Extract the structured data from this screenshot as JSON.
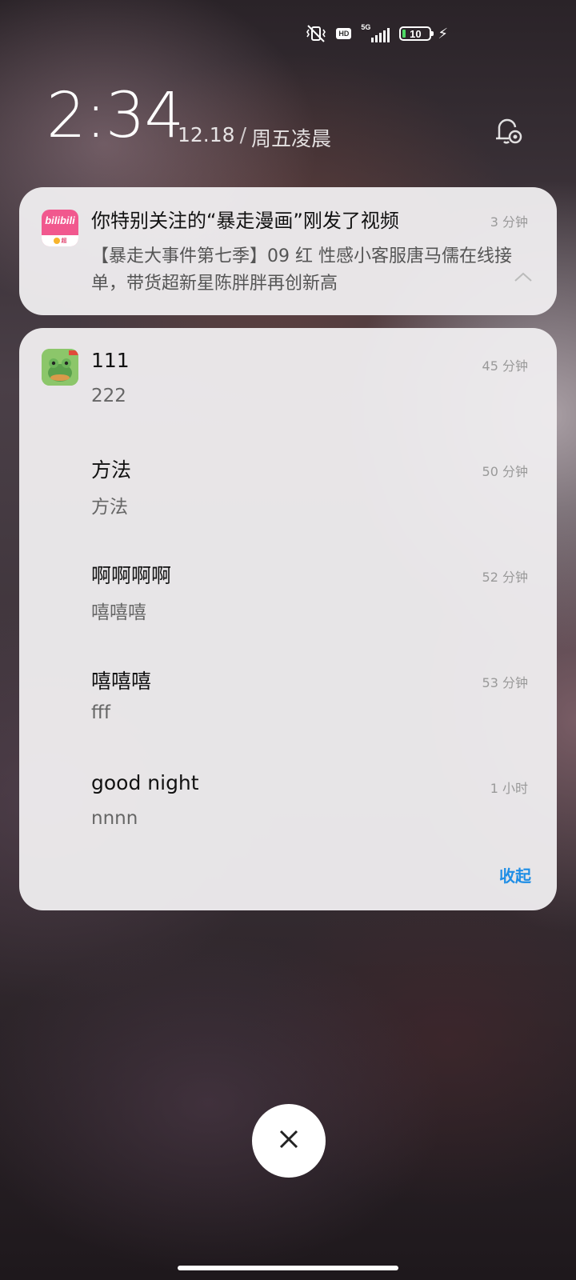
{
  "status_bar": {
    "hd_label": "HD",
    "network": "5G",
    "battery_level": "10",
    "icons": [
      "vibrate-off-icon",
      "hd-icon",
      "signal-icon",
      "battery-icon",
      "charging-icon"
    ]
  },
  "lockscreen": {
    "time": "2:34",
    "date": "12.18",
    "separator": "/",
    "weekday": "周五凌晨"
  },
  "notifications": [
    {
      "app_icon": "bilibili-icon",
      "title": "你特别关注的“暴走漫画”刚发了视频",
      "time": "3 分钟",
      "body": "【暴走大事件第七季】09 红 性感小客服唐马儒在线接单，带货超新星陈胖胖再创新高"
    }
  ],
  "group": {
    "app_icon": "frog-app-icon",
    "items": [
      {
        "title": "111",
        "body": "222",
        "time": "45 分钟"
      },
      {
        "title": "方法",
        "body": "方法",
        "time": "50 分钟"
      },
      {
        "title": "啊啊啊啊",
        "body": "嘻嘻嘻",
        "time": "52 分钟"
      },
      {
        "title": "嘻嘻嘻",
        "body": "fff",
        "time": "53 分钟"
      },
      {
        "title": "good night",
        "body": "nnnn",
        "time": "1 小时"
      }
    ],
    "collapse_label": "收起"
  },
  "colors": {
    "accent": "#1e8ee6",
    "card_bg": "#eeecee",
    "bilibili_pink": "#f1588e"
  }
}
